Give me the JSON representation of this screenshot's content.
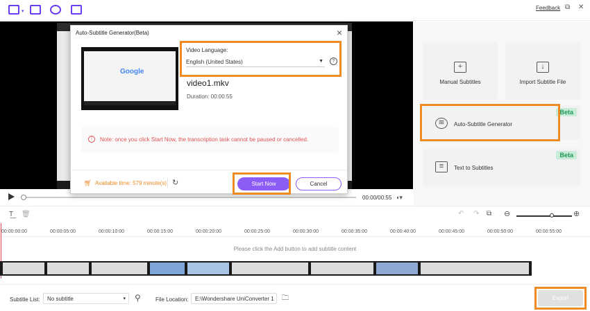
{
  "toolbar": {
    "feedback_label": "Feedback"
  },
  "player": {
    "timecode": "00:00/00:55"
  },
  "right_panel": {
    "manual_subtitles": "Manual Subtitles",
    "import_subtitle_file": "Import Subtitle File",
    "auto_subtitle_generator": "Auto-Subtitle Generator",
    "text_to_subtitles": "Text to Subtitles",
    "beta_label": "Beta"
  },
  "modal": {
    "title": "Auto-Subtitle Generator(Beta)",
    "video_language_label": "Video Language:",
    "video_language_value": "English (United States)",
    "thumbnail_logo": "Google",
    "filename": "video1.mkv",
    "duration": "Duration:   00:00:55",
    "note": "Note: once you click Start Now, the transcription task cannot be paused or cancelled.",
    "available_time": "Available time: 579 minute(s)",
    "start_button": "Start Now",
    "cancel_button": "Cancel"
  },
  "timeline": {
    "ticks": [
      "00:00:00:00",
      "00:00:05:00",
      "00:00:10:00",
      "00:00:15:00",
      "00:00:20:00",
      "00:00:25:00",
      "00:00:30:00",
      "00:00:35:00",
      "00:00:40:00",
      "00:00:45:00",
      "00:00:50:00",
      "00:00:55:00"
    ],
    "empty_message": "Please click the Add button to add subtitle content"
  },
  "bottom": {
    "subtitle_list_label": "Subtitle List:",
    "subtitle_list_value": "No subtitle",
    "file_location_label": "File Location:",
    "file_location_value": "E:\\Wondershare UniConverter 1",
    "export_button": "Export"
  },
  "colors": {
    "accent": "#8b5cf6",
    "highlight": "#f08a24",
    "beta_bg": "#c9ecd8",
    "beta_text": "#1f9a55",
    "warning": "#e05353"
  }
}
